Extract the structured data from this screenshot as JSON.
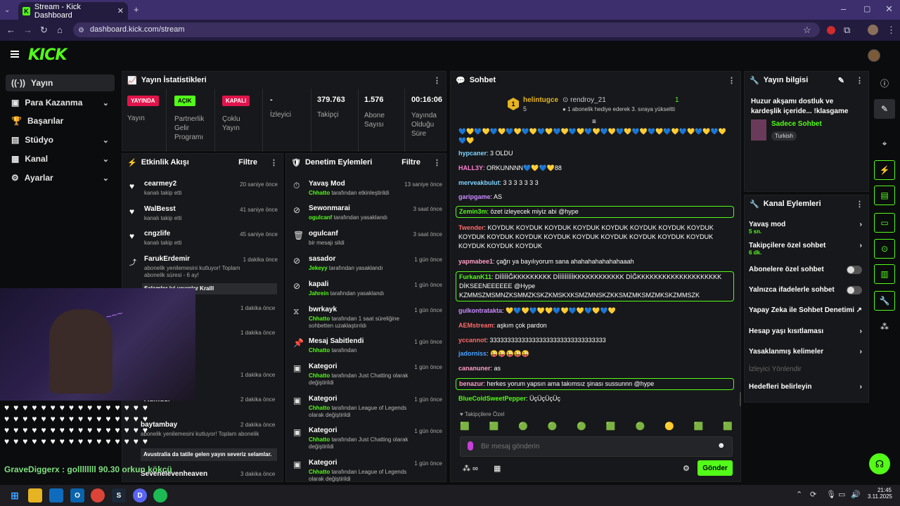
{
  "browser": {
    "tab_title": "Stream - Kick Dashboard",
    "url": "dashboard.kick.com/stream"
  },
  "sidebar": {
    "items": [
      {
        "label": "Yayın"
      },
      {
        "label": "Para Kazanma"
      },
      {
        "label": "Başarılar"
      },
      {
        "label": "Stüdyo"
      },
      {
        "label": "Kanal"
      },
      {
        "label": "Ayarlar"
      }
    ]
  },
  "stats": {
    "title": "Yayın İstatistikleri",
    "badges": [
      {
        "text": "YAYINDA",
        "label": "Yayın"
      },
      {
        "text": "AÇIK",
        "label": "Partnerlik Gelir Programı"
      },
      {
        "text": "KAPALI",
        "label": "Çoklu Yayın"
      }
    ],
    "cols": [
      {
        "value": "-",
        "label": "İzleyici"
      },
      {
        "value": "379.763",
        "label": "Takipçi"
      },
      {
        "value": "1.576",
        "label": "Abone Sayısı"
      },
      {
        "value": "00:16:06",
        "label": "Yayında Olduğu Süre"
      }
    ]
  },
  "activity": {
    "title": "Etkinlik Akışı",
    "filter": "Filtre",
    "events": [
      {
        "name": "cearmey2",
        "sub": "kanalı takip etti",
        "time": "20 saniye önce"
      },
      {
        "name": "WalBesst",
        "sub": "kanalı takip etti",
        "time": "41 saniye önce"
      },
      {
        "name": "cngzlife",
        "sub": "kanalı takip etti",
        "time": "45 saniye önce"
      },
      {
        "name": "FarukErdemir",
        "sub": "abonelik yenilemesini kutluyor! Toplam abonelik süresi - 6 ay!",
        "time": "1 dakika önce",
        "msg": "Selamlar iyi yayınlar Kralll"
      },
      {
        "time": "1 dakika önce"
      },
      {
        "time": "1 dakika önce"
      },
      {
        "time": "1 dakika önce"
      },
      {
        "name": "Admusi",
        "time": "2 dakika önce"
      },
      {
        "name": "baytambay",
        "sub": "abonelik yenilemesini kutluyor! Toplam abonelik",
        "time": "2 dakika önce",
        "msg": "Avustralia da tatile gelen yayın severiz selamlar."
      },
      {
        "name": "Sevenelevenheaven",
        "time": "3 dakika önce"
      }
    ]
  },
  "moderation": {
    "title": "Denetim Eylemleri",
    "filter": "Filtre",
    "items": [
      {
        "name": "Yavaş Mod",
        "actor": "Chhatto",
        "sub": " tarafından etkinleştirildi",
        "time": "13 saniye önce"
      },
      {
        "name": "Sewonmarai",
        "actor": "ogulcanf",
        "sub": " tarafından yasaklandı",
        "time": "3 saat önce"
      },
      {
        "name": "ogulcanf",
        "actor": "",
        "sub": "bir mesajı sildi",
        "time": "3 saat önce"
      },
      {
        "name": "sasador",
        "actor": "Jekeyy",
        "sub": " tarafından yasaklandı",
        "time": "1 gün önce"
      },
      {
        "name": "kapali",
        "actor": "Jahrein",
        "sub": " tarafından yasaklandı",
        "time": "1 gün önce"
      },
      {
        "name": "bwrkayk",
        "actor": "Chhatto",
        "sub": " tarafından 1 saat süreliğine sohbetten uzaklaştırıldı",
        "time": "1 gün önce"
      },
      {
        "name": "Mesaj Sabitlendi",
        "actor": "Chhatto",
        "sub": " tarafından",
        "time": "1 gün önce"
      },
      {
        "name": "Kategori",
        "actor": "Chhatto",
        "sub": " tarafından Just Chatting olarak değiştirildi",
        "time": "1 gün önce"
      },
      {
        "name": "Kategori",
        "actor": "Chhatto",
        "sub": " tarafından League of Legends olarak değiştirildi",
        "time": "1 gün önce"
      },
      {
        "name": "Kategori",
        "actor": "Chhatto",
        "sub": " tarafından Just Chatting olarak değiştirildi",
        "time": "1 gün önce"
      },
      {
        "name": "Kategori",
        "actor": "Chhatto",
        "sub": " tarafından League of Legends olarak değiştirildi",
        "time": "1 gün önce"
      }
    ]
  },
  "chat": {
    "title": "Sohbet",
    "leader": {
      "name": "helintugce",
      "count": "5",
      "rank": "1",
      "second": "rendroy_21",
      "second_count": "1",
      "note": "1 abonelik hediye ederek 3. sıraya yükseltti"
    },
    "messages": [
      {
        "user": "",
        "text": "💙💛💙💛💙💛💙💛💙💛💙💛💙💛💙💛💙💛💙💛💙💛💙💛💙💛💙💛💙💛💙💛💙💛💙💛"
      },
      {
        "user": "hypcaner",
        "color": "#7fd3ff",
        "text": "3 OLDU"
      },
      {
        "user": "HALL3Y",
        "color": "#ff7fd0",
        "text": "ORKUNNNN💙💛💙💛88"
      },
      {
        "user": "merveakbulut",
        "color": "#7fd3ff",
        "text": "3 3 3 3 3 3 3"
      },
      {
        "user": "garipgame",
        "color": "#c98bff",
        "text": "AS"
      },
      {
        "user": "Zemin3m",
        "color": "#53fc18",
        "text": "özet izleyecek miyiz abi @hype",
        "hl": true
      },
      {
        "user": "Twender",
        "color": "#ff6a6a",
        "text": "KOYDUK KOYDUK KOYDUK KOYDUK KOYDUK KOYDUK KOYDUK KOYDUK KOYDUK KOYDUK KOYDUK KOYDUK KOYDUK KOYDUK KOYDUK KOYDUK KOYDUK KOYDUK KOYDUK KOYDUK"
      },
      {
        "user": "yapmabee1",
        "color": "#ff9ec7",
        "text": "çağrı ya bayılıyorum sana ahahahahahahahaaah"
      },
      {
        "user": "FurkanK11",
        "color": "#53fc18",
        "text": "DİİİİİĞKKKKKKKKK DİİİİİİİİİKKKKKKKKKKKK DİĞKKKKKKKKKKKKKKKKKKKK DİKSEENEEEEEE @Hype KZMMSZMSMNZKSMMZKSKZKMSKXKSMZMNSKZKKSMZMKSMZMKSKZMMSZK",
        "hl": true
      },
      {
        "user": "gulkontratakta",
        "color": "#c98bff",
        "text": "💛💙💛💙💛💛💙💛💙💛💙💛💙💛"
      },
      {
        "user": "AEMstream",
        "color": "#ff6a6a",
        "text": "aşkım çok pardon"
      },
      {
        "user": "yccannot",
        "color": "#ff6a6a",
        "text": "333333333333333333333333333333333"
      },
      {
        "user": "jadorniss",
        "color": "#4aa3ff",
        "text": "😜😜😜😜😜"
      },
      {
        "user": "cananuner",
        "color": "#ff9ec7",
        "text": "as"
      },
      {
        "user": "benazur",
        "color": "#ff9ec7",
        "text": "herkes yorum yapsın ama takımsız şinası sussunnn @hype",
        "hl": true
      },
      {
        "user": "BlueColdSweetPepper",
        "color": "#53fc18",
        "text": "ÜçÜçÜçÜç"
      }
    ],
    "follower_only": "Takipçilere Özel",
    "placeholder": "Bir mesaj gönderin",
    "send": "Gönder"
  },
  "stream_info": {
    "title": "Yayın bilgisi",
    "stream_title": "Huzur akşamı dostluk ve kardeşlik içeride... !klasgame",
    "category": "Sadece Sohbet",
    "tag": "Turkish"
  },
  "channel_actions": {
    "title": "Kanal Eylemleri",
    "items": [
      {
        "label": "Yavaş mod",
        "sub": "5 sn.",
        "type": "chev"
      },
      {
        "label": "Takipçilere özel sohbet",
        "sub": "6 dk.",
        "type": "chev"
      },
      {
        "label": "Abonelere özel sohbet",
        "type": "toggle"
      },
      {
        "label": "Yalnızca ifadelerle sohbet",
        "type": "toggle"
      },
      {
        "label": "Yapay Zeka ile Sohbet Denetimi",
        "type": "ext"
      },
      {
        "label": "Hesap yaşı kısıtlaması",
        "type": "chev"
      },
      {
        "label": "Yasaklanmış kelimeler",
        "type": "chev"
      },
      {
        "label": "İzleyici Yönlendir",
        "type": "disabled"
      },
      {
        "label": "Hedefleri belirleyin",
        "type": "chev"
      }
    ]
  },
  "overlay": {
    "chat_line": "GraveDiggerx : gollllllll 90.30 orkun kökcü"
  },
  "taskbar": {
    "time": "21:45",
    "date": "3.11.2025"
  },
  "colors": {
    "accent": "#53fc18",
    "live": "#e0144c",
    "bg": "#0b0c0e",
    "panel": "#17181b"
  }
}
